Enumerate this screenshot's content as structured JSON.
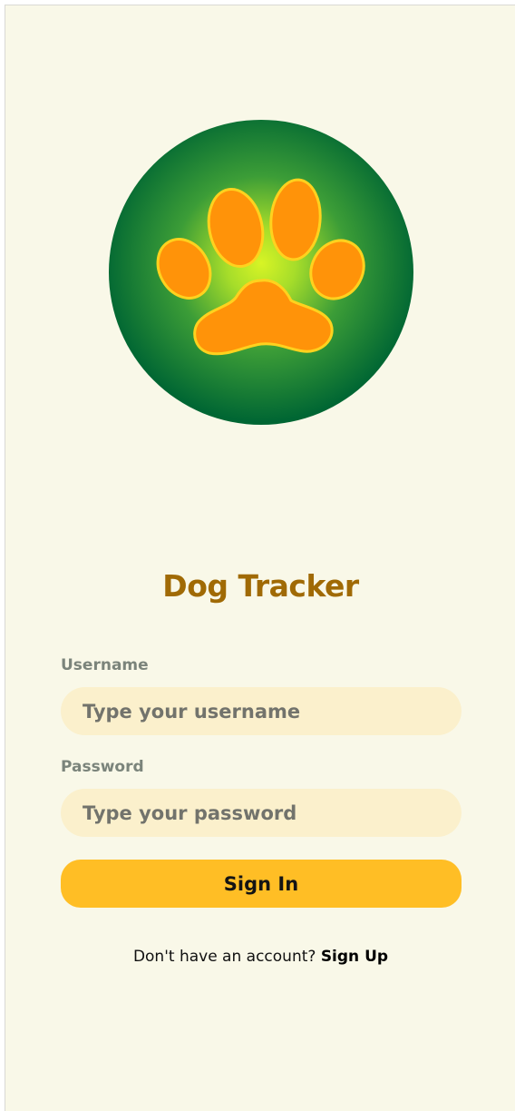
{
  "app": {
    "title": "Dog Tracker",
    "logo_icon": "paw-icon"
  },
  "login_form": {
    "username": {
      "label": "Username",
      "value": "",
      "placeholder": "Type your username"
    },
    "password": {
      "label": "Password",
      "value": "",
      "placeholder": "Type your password"
    },
    "submit_label": "Sign In"
  },
  "signup": {
    "prompt": "Don't have an account?",
    "link_label": "Sign Up"
  },
  "colors": {
    "page_background": "#f9f8e8",
    "title": "#a06a05",
    "input_background": "#fbf0cc",
    "button_background": "#ffbe25",
    "logo_outer_green": "#006633",
    "logo_inner_yellow": "#d8f425",
    "paw_orange": "#ff9309"
  }
}
